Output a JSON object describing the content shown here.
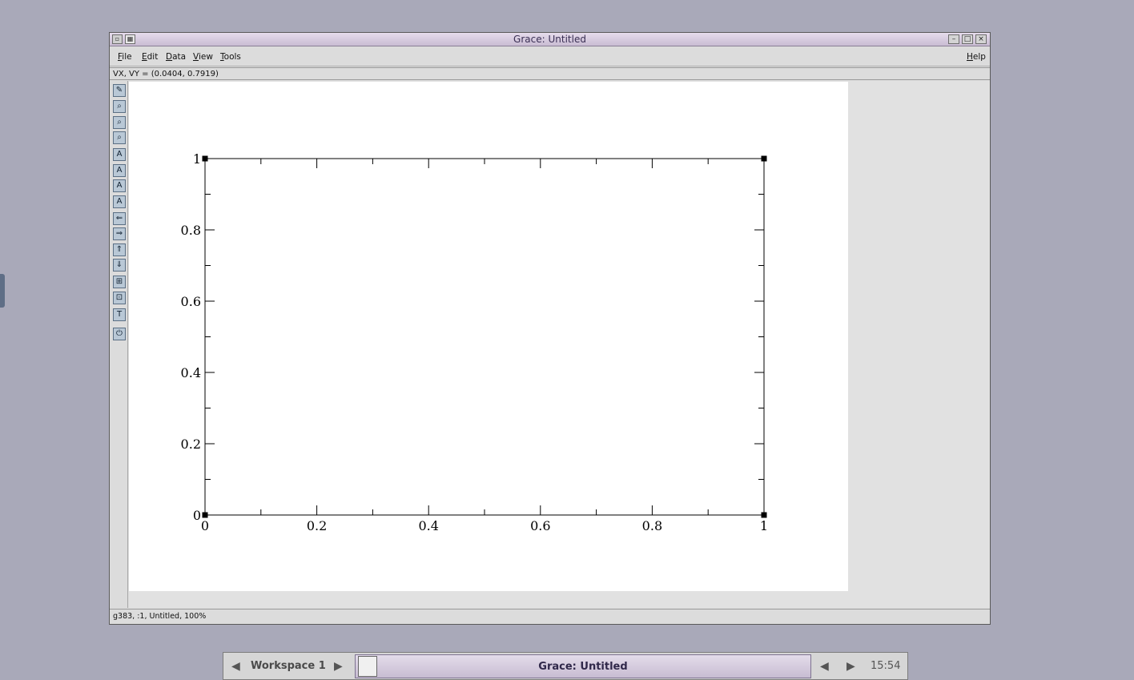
{
  "window": {
    "title": "Grace: Untitled"
  },
  "menubar": {
    "file": {
      "accel": "F",
      "rest": "ile"
    },
    "edit": {
      "accel": "E",
      "rest": "dit"
    },
    "data": {
      "accel": "D",
      "rest": "ata"
    },
    "view": {
      "accel": "V",
      "rest": "iew"
    },
    "tools": {
      "accel": "T",
      "rest": "ools"
    },
    "help": {
      "accel": "H",
      "rest": "elp"
    }
  },
  "coords": {
    "text": "VX, VY = (0.0404, 0.7919)"
  },
  "status": {
    "text": "g383, :1, Untitled, 100%"
  },
  "toolbar": {
    "tools": [
      {
        "name": "draw-icon",
        "glyph": "✎"
      },
      {
        "name": "zoom-icon",
        "glyph": "⌕"
      },
      {
        "name": "zoom-x-icon",
        "glyph": "⌕"
      },
      {
        "name": "zoom-y-icon",
        "glyph": "⌕"
      },
      {
        "name": "autoscale-icon",
        "glyph": "A"
      },
      {
        "name": "autoscale-x-icon",
        "glyph": "A"
      },
      {
        "name": "autoscale-y-icon",
        "glyph": "A"
      },
      {
        "name": "autoscale-xy-icon",
        "glyph": "A"
      },
      {
        "name": "scroll-left-icon",
        "glyph": "⇐"
      },
      {
        "name": "scroll-right-icon",
        "glyph": "⇒"
      },
      {
        "name": "scroll-up-icon",
        "glyph": "⇑"
      },
      {
        "name": "scroll-down-icon",
        "glyph": "⇓"
      },
      {
        "name": "expand-icon",
        "glyph": "⊞"
      },
      {
        "name": "shrink-icon",
        "glyph": "⊡"
      },
      {
        "name": "text-icon",
        "glyph": "T"
      },
      {
        "name": "power-icon",
        "glyph": "⏻"
      }
    ]
  },
  "chart_data": {
    "type": "line",
    "series": [],
    "xlim": [
      0,
      1
    ],
    "ylim": [
      0,
      1
    ],
    "x_ticks": [
      "0",
      "0.2",
      "0.4",
      "0.6",
      "0.8",
      "1"
    ],
    "y_ticks": [
      "0",
      "0.2",
      "0.4",
      "0.6",
      "0.8",
      "1"
    ],
    "grid": false
  },
  "taskbar": {
    "workspace": "Workspace 1",
    "task_title": "Grace: Untitled",
    "clock": "15:54"
  }
}
